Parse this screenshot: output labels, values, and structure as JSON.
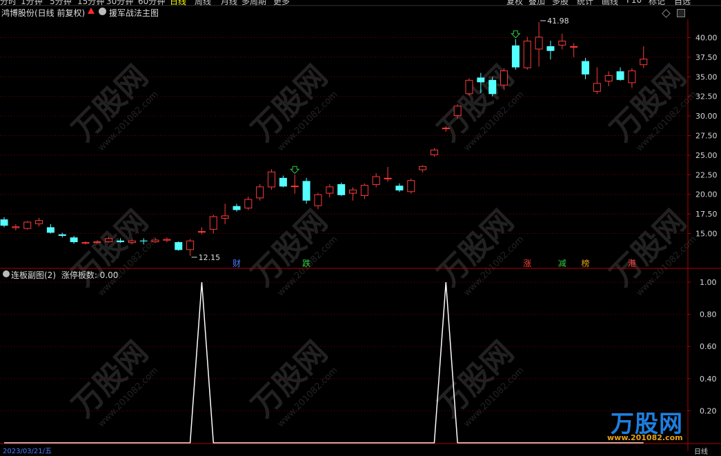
{
  "toolbar": {
    "periods": [
      "分时",
      "1分钟",
      "5分钟",
      "15分钟",
      "30分钟",
      "60分钟",
      "日线",
      "周线",
      "月线",
      "多周期",
      "更多"
    ],
    "active_period": "日线",
    "right_buttons": [
      "复权",
      "叠加",
      "多股",
      "统计",
      "画线",
      "F10",
      "标记",
      "自选"
    ]
  },
  "header": {
    "stock_name": "鸿博股份(日线 前复权)",
    "indicator_name": "援军战法主图"
  },
  "sub_panel": {
    "title": "连板副图(2)",
    "value_label": "涨停板数: 0.00"
  },
  "price_axis": {
    "ticks": [
      "40.00",
      "37.50",
      "35.00",
      "32.50",
      "30.00",
      "27.50",
      "25.00",
      "22.50",
      "20.00",
      "17.50",
      "15.00"
    ]
  },
  "sub_axis": {
    "ticks": [
      "1.00",
      "0.80",
      "0.60",
      "0.40",
      "0.20"
    ]
  },
  "annotations": {
    "low_price": "12.15",
    "high_price": "41.98"
  },
  "event_markers": [
    {
      "text": "财",
      "color": "#4a7bff"
    },
    {
      "text": "跌",
      "color": "#2ecc40"
    },
    {
      "text": "涨",
      "color": "#ff4040"
    },
    {
      "text": "减",
      "color": "#2ecc40"
    },
    {
      "text": "榜",
      "color": "#e8a317"
    },
    {
      "text": "港",
      "color": "#ff4040"
    }
  ],
  "watermark": {
    "brand": "万股网",
    "url": "www.201082.com"
  },
  "footer": {
    "date": "2023/03/21/五",
    "period": "日线"
  },
  "colors": {
    "up": "#ff3b3b",
    "down": "#54ffff",
    "grid": "#7a0000",
    "axis": "#b00000",
    "line": "#ffffff"
  },
  "chart_data": [
    {
      "type": "candlestick",
      "title": "援军战法主图",
      "ylim": [
        12.15,
        41.98
      ],
      "y_ticks": [
        15.0,
        17.5,
        20.0,
        22.5,
        25.0,
        27.5,
        30.0,
        32.5,
        35.0,
        37.5,
        40.0
      ],
      "candles": [
        {
          "o": 16.8,
          "h": 17.1,
          "l": 15.8,
          "c": 16.0
        },
        {
          "o": 15.7,
          "h": 16.2,
          "l": 15.4,
          "c": 15.9
        },
        {
          "o": 15.6,
          "h": 16.6,
          "l": 15.5,
          "c": 16.5
        },
        {
          "o": 16.2,
          "h": 17.0,
          "l": 15.9,
          "c": 16.7
        },
        {
          "o": 15.8,
          "h": 16.2,
          "l": 15.0,
          "c": 15.1
        },
        {
          "o": 14.9,
          "h": 15.1,
          "l": 14.5,
          "c": 14.7
        },
        {
          "o": 14.5,
          "h": 14.7,
          "l": 13.7,
          "c": 13.9
        },
        {
          "o": 13.7,
          "h": 14.0,
          "l": 13.6,
          "c": 13.9
        },
        {
          "o": 13.8,
          "h": 14.1,
          "l": 13.7,
          "c": 14.0
        },
        {
          "o": 13.9,
          "h": 14.6,
          "l": 13.8,
          "c": 14.4
        },
        {
          "o": 14.1,
          "h": 14.4,
          "l": 13.8,
          "c": 13.9
        },
        {
          "o": 13.8,
          "h": 14.3,
          "l": 13.7,
          "c": 14.1
        },
        {
          "o": 14.1,
          "h": 14.4,
          "l": 13.6,
          "c": 14.0
        },
        {
          "o": 13.9,
          "h": 14.4,
          "l": 13.8,
          "c": 14.2
        },
        {
          "o": 14.1,
          "h": 14.5,
          "l": 13.9,
          "c": 14.3
        },
        {
          "o": 13.9,
          "h": 14.0,
          "l": 12.8,
          "c": 12.9
        },
        {
          "o": 12.9,
          "h": 14.3,
          "l": 12.15,
          "c": 14.1
        },
        {
          "o": 15.3,
          "h": 15.8,
          "l": 14.9,
          "c": 15.3
        },
        {
          "o": 15.5,
          "h": 17.4,
          "l": 15.0,
          "c": 17.2
        },
        {
          "o": 16.9,
          "h": 18.8,
          "l": 16.2,
          "c": 17.3
        },
        {
          "o": 18.5,
          "h": 18.8,
          "l": 17.8,
          "c": 18.0
        },
        {
          "o": 18.2,
          "h": 19.7,
          "l": 18.0,
          "c": 19.4
        },
        {
          "o": 19.5,
          "h": 21.3,
          "l": 19.2,
          "c": 21.0
        },
        {
          "o": 20.9,
          "h": 23.2,
          "l": 20.6,
          "c": 22.9
        },
        {
          "o": 22.1,
          "h": 22.4,
          "l": 20.9,
          "c": 21.0
        },
        {
          "o": 21.1,
          "h": 22.5,
          "l": 20.1,
          "c": 21.1
        },
        {
          "o": 21.7,
          "h": 22.1,
          "l": 18.8,
          "c": 19.2
        },
        {
          "o": 18.5,
          "h": 20.2,
          "l": 18.1,
          "c": 20.0
        },
        {
          "o": 20.1,
          "h": 21.3,
          "l": 19.6,
          "c": 21.0
        },
        {
          "o": 21.3,
          "h": 21.5,
          "l": 19.8,
          "c": 19.9
        },
        {
          "o": 20.1,
          "h": 20.9,
          "l": 19.2,
          "c": 20.6
        },
        {
          "o": 19.8,
          "h": 21.4,
          "l": 19.4,
          "c": 21.2
        },
        {
          "o": 21.2,
          "h": 22.7,
          "l": 20.9,
          "c": 22.3
        },
        {
          "o": 22.0,
          "h": 23.5,
          "l": 21.6,
          "c": 22.1
        },
        {
          "o": 21.1,
          "h": 21.4,
          "l": 20.3,
          "c": 20.5
        },
        {
          "o": 20.3,
          "h": 22.0,
          "l": 20.1,
          "c": 21.8
        },
        {
          "o": 23.1,
          "h": 23.7,
          "l": 22.8,
          "c": 23.6
        },
        {
          "o": 25.0,
          "h": 25.9,
          "l": 24.8,
          "c": 25.7
        },
        {
          "o": 28.4,
          "h": 28.7,
          "l": 28.0,
          "c": 28.5
        },
        {
          "o": 30.0,
          "h": 31.5,
          "l": 29.6,
          "c": 31.3
        },
        {
          "o": 32.8,
          "h": 34.8,
          "l": 32.6,
          "c": 34.6
        },
        {
          "o": 34.9,
          "h": 35.5,
          "l": 32.9,
          "c": 34.3
        },
        {
          "o": 34.6,
          "h": 35.0,
          "l": 32.5,
          "c": 32.8
        },
        {
          "o": 33.9,
          "h": 36.1,
          "l": 33.3,
          "c": 35.8
        },
        {
          "o": 39.0,
          "h": 39.8,
          "l": 35.9,
          "c": 36.2
        },
        {
          "o": 36.1,
          "h": 40.1,
          "l": 35.9,
          "c": 39.6
        },
        {
          "o": 38.5,
          "h": 41.98,
          "l": 36.3,
          "c": 40.1
        },
        {
          "o": 38.9,
          "h": 39.6,
          "l": 37.2,
          "c": 38.3
        },
        {
          "o": 39.0,
          "h": 40.5,
          "l": 38.5,
          "c": 39.6
        },
        {
          "o": 38.9,
          "h": 39.3,
          "l": 37.5,
          "c": 38.9
        },
        {
          "o": 37.0,
          "h": 37.4,
          "l": 34.7,
          "c": 35.3
        },
        {
          "o": 33.1,
          "h": 36.2,
          "l": 32.8,
          "c": 34.2
        },
        {
          "o": 34.4,
          "h": 35.7,
          "l": 33.8,
          "c": 35.2
        },
        {
          "o": 35.7,
          "h": 36.2,
          "l": 34.5,
          "c": 34.6
        },
        {
          "o": 34.2,
          "h": 36.1,
          "l": 33.6,
          "c": 35.8
        },
        {
          "o": 36.5,
          "h": 38.9,
          "l": 36.1,
          "c": 37.3
        }
      ]
    },
    {
      "type": "line",
      "title": "连板副图(2)",
      "series": [
        {
          "name": "涨停板数",
          "values": [
            0,
            0,
            0,
            0,
            0,
            0,
            0,
            0,
            0,
            0,
            0,
            0,
            0,
            0,
            0,
            0,
            0,
            1,
            0,
            0,
            0,
            0,
            0,
            0,
            0,
            0,
            0,
            0,
            0,
            0,
            0,
            0,
            0,
            0,
            0,
            0,
            0,
            0,
            1,
            0,
            0,
            0,
            0,
            0,
            0,
            0,
            0,
            0,
            0,
            0,
            0,
            0,
            0,
            0,
            0,
            0
          ]
        }
      ],
      "ylim": [
        0,
        1.0
      ],
      "y_ticks": [
        0.2,
        0.4,
        0.6,
        0.8,
        1.0
      ]
    }
  ]
}
